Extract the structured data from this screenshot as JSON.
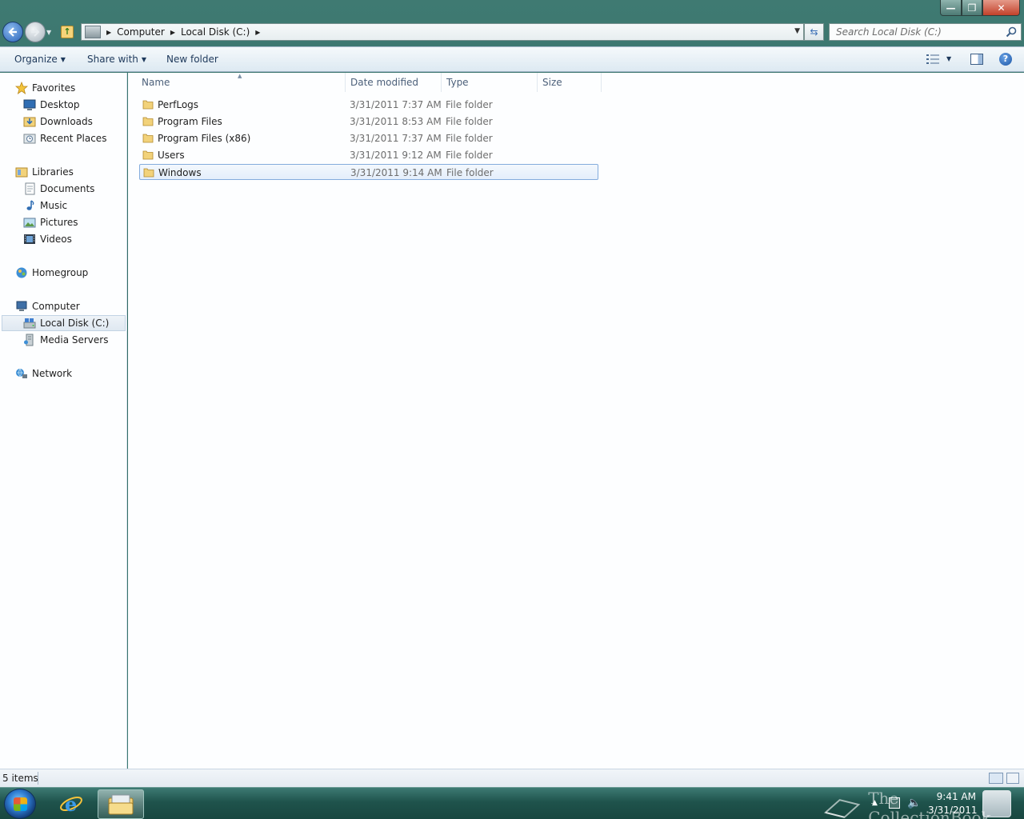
{
  "window": {
    "controls": {
      "minimize": "—",
      "maximize": "❐",
      "close": "✕"
    }
  },
  "address": {
    "breadcrumbs": [
      "Computer",
      "Local Disk (C:)"
    ],
    "search_placeholder": "Search Local Disk (C:)"
  },
  "toolbar": {
    "organize_label": "Organize",
    "share_label": "Share with",
    "new_folder_label": "New folder"
  },
  "sidebar": {
    "favorites": {
      "label": "Favorites",
      "items": [
        "Desktop",
        "Downloads",
        "Recent Places"
      ]
    },
    "libraries": {
      "label": "Libraries",
      "items": [
        "Documents",
        "Music",
        "Pictures",
        "Videos"
      ]
    },
    "homegroup": {
      "label": "Homegroup"
    },
    "computer": {
      "label": "Computer",
      "items": [
        "Local Disk (C:)",
        "Media Servers"
      ],
      "selected": "Local Disk (C:)"
    },
    "network": {
      "label": "Network"
    }
  },
  "file_list": {
    "columns": [
      "Name",
      "Date modified",
      "Type",
      "Size"
    ],
    "rows": [
      {
        "name": "PerfLogs",
        "date": "3/31/2011 7:37 AM",
        "type": "File folder",
        "size": ""
      },
      {
        "name": "Program Files",
        "date": "3/31/2011 8:53 AM",
        "type": "File folder",
        "size": ""
      },
      {
        "name": "Program Files (x86)",
        "date": "3/31/2011 7:37 AM",
        "type": "File folder",
        "size": ""
      },
      {
        "name": "Users",
        "date": "3/31/2011 9:12 AM",
        "type": "File folder",
        "size": ""
      },
      {
        "name": "Windows",
        "date": "3/31/2011 9:14 AM",
        "type": "File folder",
        "size": ""
      }
    ],
    "selected": "Windows"
  },
  "status": {
    "item_count": "5 items"
  },
  "taskbar": {
    "clock_time": "9:41 AM",
    "clock_date": "3/31/2011",
    "watermark": "The CollectionBook"
  },
  "colors": {
    "accent": "#1e395b",
    "selection_border": "#84acdd",
    "taskbar": "#1f534c"
  }
}
